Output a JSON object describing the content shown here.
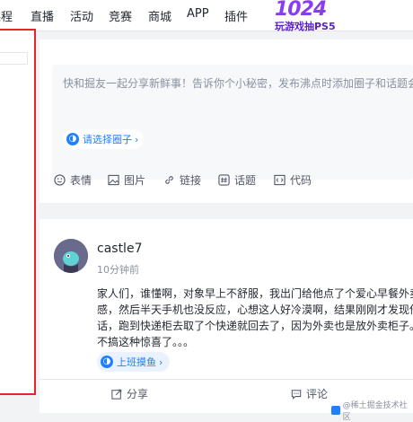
{
  "nav": {
    "items": [
      {
        "label": "课程"
      },
      {
        "label": "直播"
      },
      {
        "label": "活动"
      },
      {
        "label": "竞赛"
      },
      {
        "label": "商城"
      },
      {
        "label": "APP"
      },
      {
        "label": "插件"
      }
    ],
    "promo_title": "1024",
    "promo_subtitle": "玩游戏抽PS5"
  },
  "editor": {
    "placeholder": "快和掘友一起分享新鲜事！告诉你个小秘密，发布沸点时添加圈子和话题会被",
    "circle_label": "请选择圈子",
    "tools": [
      {
        "label": "表情",
        "icon": "smile-icon"
      },
      {
        "label": "图片",
        "icon": "image-icon"
      },
      {
        "label": "链接",
        "icon": "link-icon"
      },
      {
        "label": "话题",
        "icon": "hashtag-icon"
      },
      {
        "label": "代码",
        "icon": "code-icon"
      }
    ]
  },
  "post": {
    "author": "castle7",
    "time": "10分钟前",
    "lines": [
      "家人们，谁懂啊，对象早上不舒服，我出门给他点了个爱心早餐外卖",
      "感，然后半天手机也没反应，心想这人好冷漠啊，结果刚刚才发现他",
      "话，跑到快递柜去取了个快递就回去了，因为外卖也是放外卖柜子。",
      "不搞这种惊喜了。。。"
    ],
    "tag": "上班摸鱼",
    "share_label": "分享",
    "comment_label": "评论"
  },
  "watermark": "@稀土掘金技术社区",
  "colors": {
    "accent": "#1e80ff",
    "highlight_border": "#e6252a",
    "promo": "#8a3cf5"
  }
}
